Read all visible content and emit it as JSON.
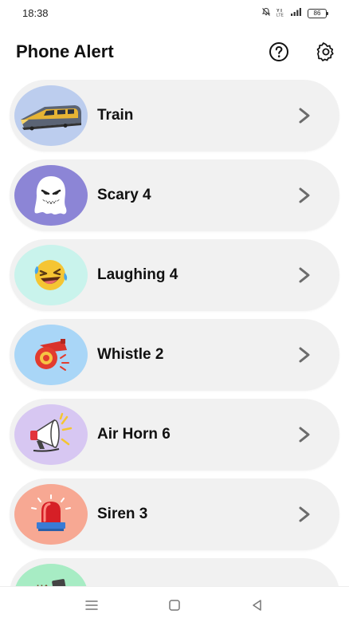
{
  "status_bar": {
    "time": "18:38",
    "battery": "86",
    "icons": [
      "mute-icon",
      "volte-icon",
      "signal-icon",
      "battery-icon"
    ]
  },
  "header": {
    "title": "Phone Alert",
    "help_icon": "help-circle-icon",
    "settings_icon": "gear-icon"
  },
  "sounds": [
    {
      "label": "Train",
      "icon": "train-icon",
      "bg": "#bccdee"
    },
    {
      "label": "Scary 4",
      "icon": "ghost-icon",
      "bg": "#8c85d6"
    },
    {
      "label": "Laughing 4",
      "icon": "laughing-emoji-icon",
      "bg": "#c9f3ec"
    },
    {
      "label": "Whistle 2",
      "icon": "whistle-icon",
      "bg": "#a9d6f7"
    },
    {
      "label": "Air Horn 6",
      "icon": "air-horn-icon",
      "bg": "#d7c7f2"
    },
    {
      "label": "Siren 3",
      "icon": "siren-icon",
      "bg": "#f7a893"
    },
    {
      "label": "",
      "icon": "partial-icon",
      "bg": "#a7ecc4"
    }
  ],
  "colors": {
    "card_bg": "#f1f1f1",
    "chevron": "#6b6b6b",
    "title_text": "#111111"
  },
  "nav_bar": {
    "icons": [
      "recents-menu-icon",
      "home-square-icon",
      "back-triangle-icon"
    ]
  }
}
